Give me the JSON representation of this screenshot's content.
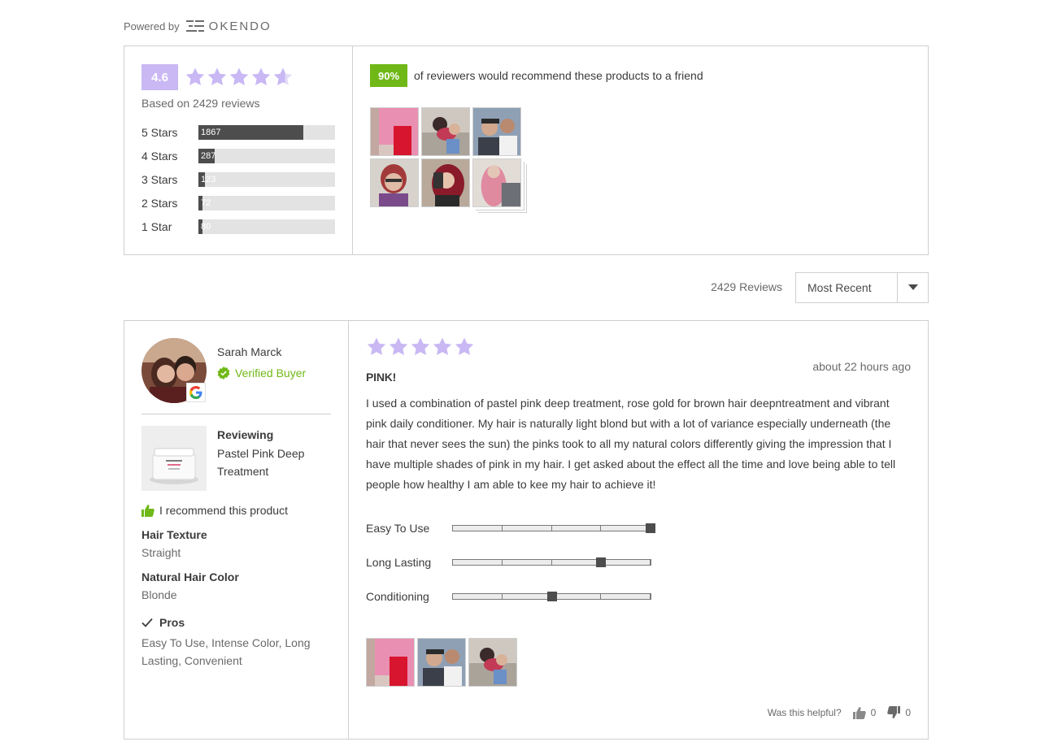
{
  "powered_by": {
    "label": "Powered by",
    "brand": "OKENDO"
  },
  "summary": {
    "average_rating": "4.6",
    "rating_value": 4.6,
    "based_on": "Based on 2429 reviews",
    "breakdown": [
      {
        "label": "5 Stars",
        "count": "1867",
        "fraction": 0.77
      },
      {
        "label": "4 Stars",
        "count": "287",
        "fraction": 0.12
      },
      {
        "label": "3 Stars",
        "count": "123",
        "fraction": 0.05
      },
      {
        "label": "2 Stars",
        "count": "72",
        "fraction": 0.03
      },
      {
        "label": "1 Star",
        "count": "80",
        "fraction": 0.03
      }
    ],
    "recommend_percent": "90%",
    "recommend_text": "of reviewers would recommend these products to a friend"
  },
  "controls": {
    "review_count": "2429 Reviews",
    "sort_value": "Most Recent"
  },
  "review": {
    "reviewer_name": "Sarah Marck",
    "verified_label": "Verified Buyer",
    "reviewing_label": "Reviewing",
    "product_name": "Pastel Pink Deep Treatment",
    "recommend_label": "I recommend this product",
    "attributes": [
      {
        "label": "Hair Texture",
        "value": "Straight"
      },
      {
        "label": "Natural Hair Color",
        "value": "Blonde"
      }
    ],
    "pros_label": "Pros",
    "pros_value": "Easy To Use, Intense Color, Long Lasting, Convenient",
    "rating": 5,
    "date": "about 22 hours ago",
    "title": "Pink!",
    "body": "I used a combination of pastel pink deep treatment, rose gold for brown hair deepntreatment and vibrant pink daily conditioner. My hair is naturally light blond but with a lot of variance especially underneath (the hair that never sees the sun) the pinks took to all my natural colors differently giving the impression that I have multiple shades of pink in my hair. I get asked about the effect all the time and love being able to tell people how healthy I am able to kee my hair to achieve it!",
    "scales": [
      {
        "label": "Easy To Use",
        "value_fraction": 1.0
      },
      {
        "label": "Long Lasting",
        "value_fraction": 0.75
      },
      {
        "label": "Conditioning",
        "value_fraction": 0.5
      }
    ],
    "helpful_label": "Was this helpful?",
    "helpful_yes": "0",
    "helpful_no": "0"
  },
  "colors": {
    "star_purple": "#c9b8f4",
    "recommend_green": "#70b817",
    "bar_fill": "#4d4d4d",
    "bar_track": "#e3e3e3"
  }
}
